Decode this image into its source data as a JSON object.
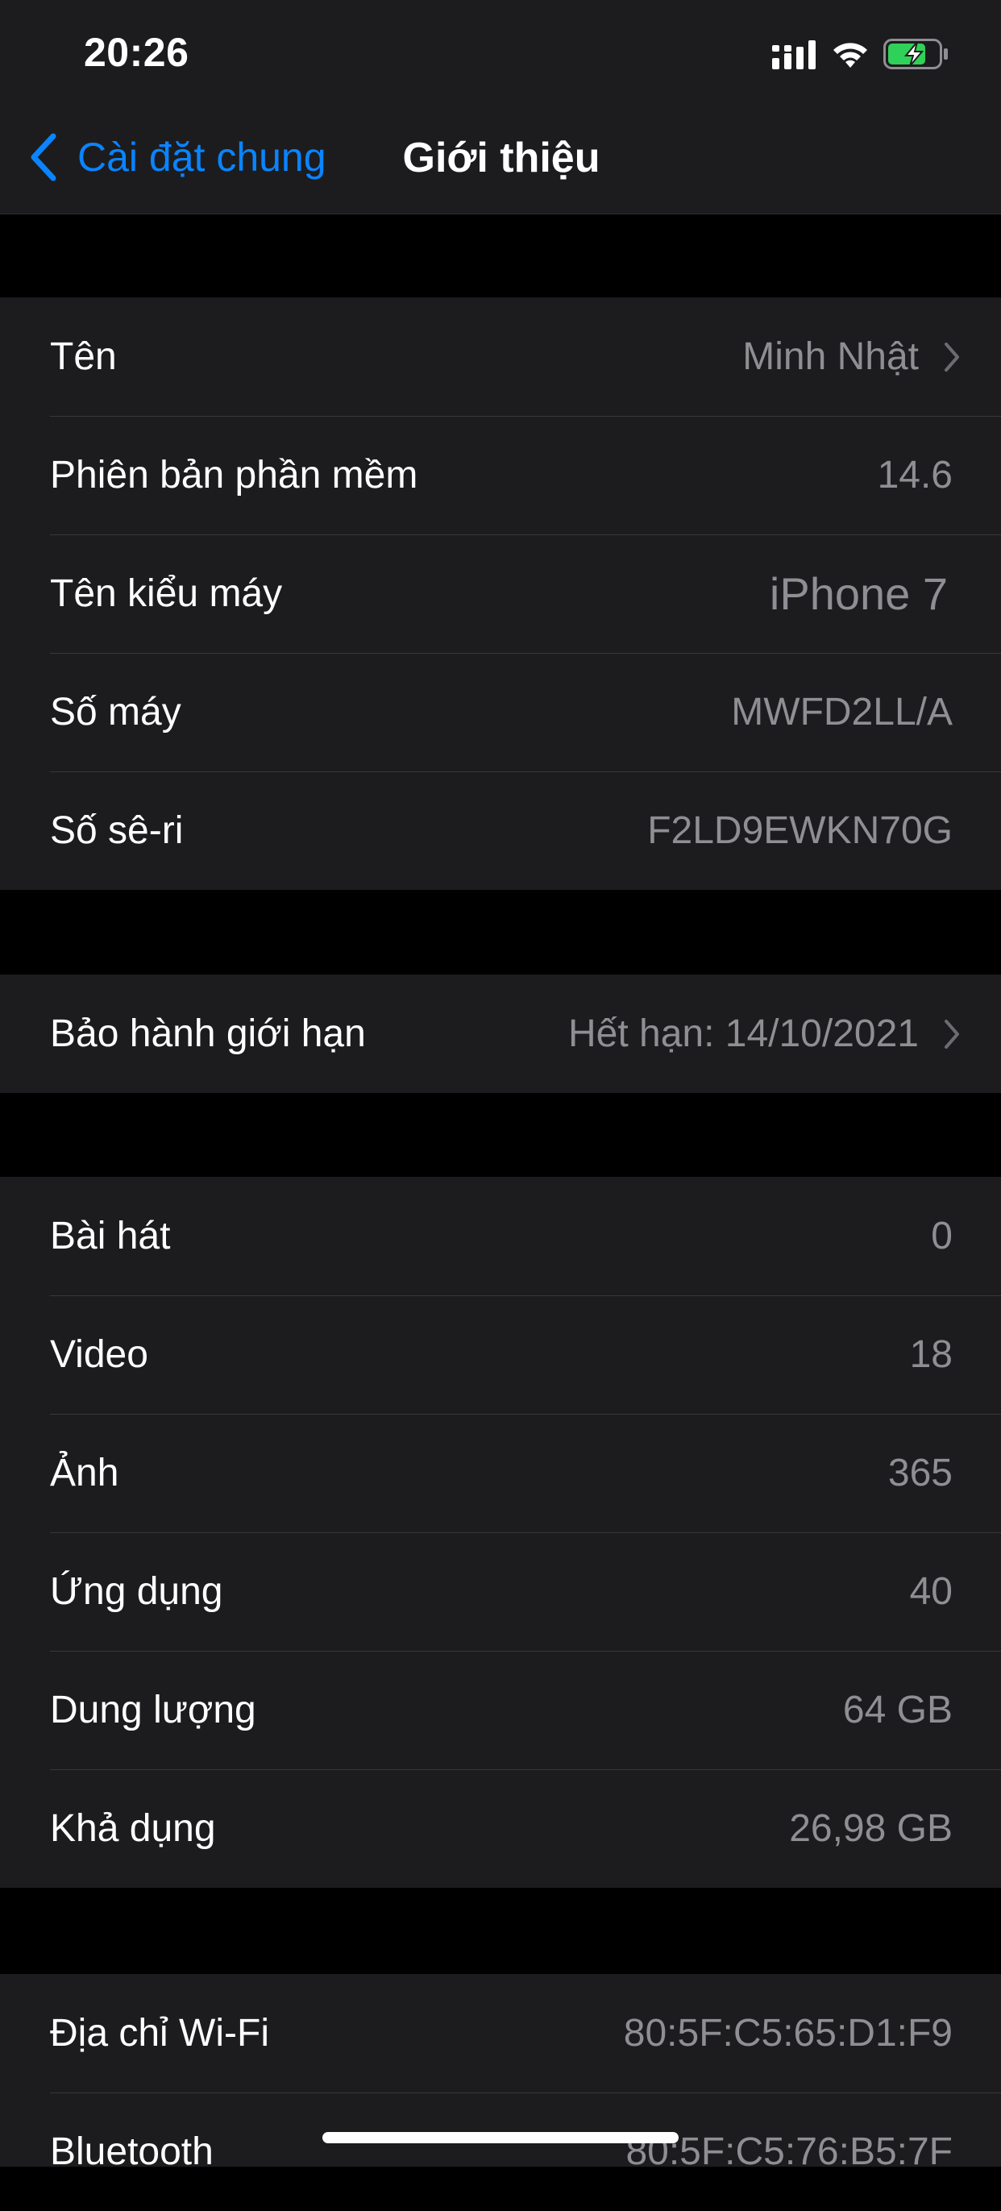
{
  "status": {
    "time": "20:26",
    "icons": [
      "signal-icon",
      "wifi-icon",
      "battery-charging-icon"
    ],
    "battery_color": "#30d158"
  },
  "nav": {
    "back_label": "Cài đặt chung",
    "title": "Giới thiệu",
    "accent": "#0a84ff"
  },
  "group1": [
    {
      "label": "Tên",
      "value": "Minh Nhật",
      "chevron": true
    },
    {
      "label": "Phiên bản phần mềm",
      "value": "14.6"
    },
    {
      "label": "Tên kiểu máy",
      "value": "iPhone 7"
    },
    {
      "label": "Số máy",
      "value": "MWFD2LL/A"
    },
    {
      "label": "Số sê-ri",
      "value": "F2LD9EWKN70G"
    }
  ],
  "group2": [
    {
      "label": "Bảo hành giới hạn",
      "value": "Hết hạn: 14/10/2021",
      "chevron": true
    }
  ],
  "group3": [
    {
      "label": "Bài hát",
      "value": "0"
    },
    {
      "label": "Video",
      "value": "18"
    },
    {
      "label": "Ảnh",
      "value": "365"
    },
    {
      "label": "Ứng dụng",
      "value": "40"
    },
    {
      "label": "Dung lượng",
      "value": "64 GB"
    },
    {
      "label": "Khả dụng",
      "value": "26,98 GB"
    }
  ],
  "group4": [
    {
      "label": "Địa chỉ Wi-Fi",
      "value": "80:5F:C5:65:D1:F9"
    },
    {
      "label": "Bluetooth",
      "value": "80:5F:C5:76:B5:7F"
    }
  ]
}
